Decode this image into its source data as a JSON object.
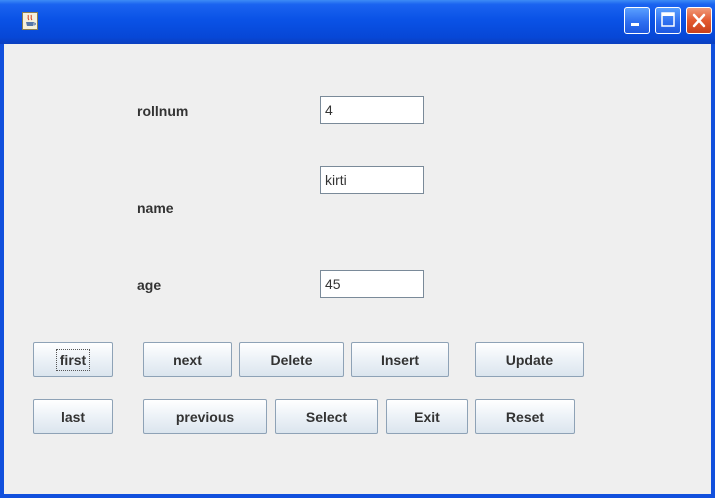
{
  "window": {
    "title": "",
    "icons": {
      "app": "java-coffee-cup-icon",
      "minimize": "minimize-icon",
      "maximize": "maximize-icon",
      "close": "close-icon"
    },
    "colors": {
      "titlebar": "#0a52e6",
      "frame": "#1150dd",
      "close": "#e35a30",
      "panel": "#efefef"
    }
  },
  "form": {
    "rollnum": {
      "label": "rollnum",
      "value": "4"
    },
    "name": {
      "label": "name",
      "value": "kirti"
    },
    "age": {
      "label": "age",
      "value": "45"
    }
  },
  "buttons": {
    "first": "first",
    "next": "next",
    "delete": "Delete",
    "insert": "Insert",
    "update": "Update",
    "last": "last",
    "previous": "previous",
    "select": "Select",
    "exit": "Exit",
    "reset": "Reset"
  }
}
